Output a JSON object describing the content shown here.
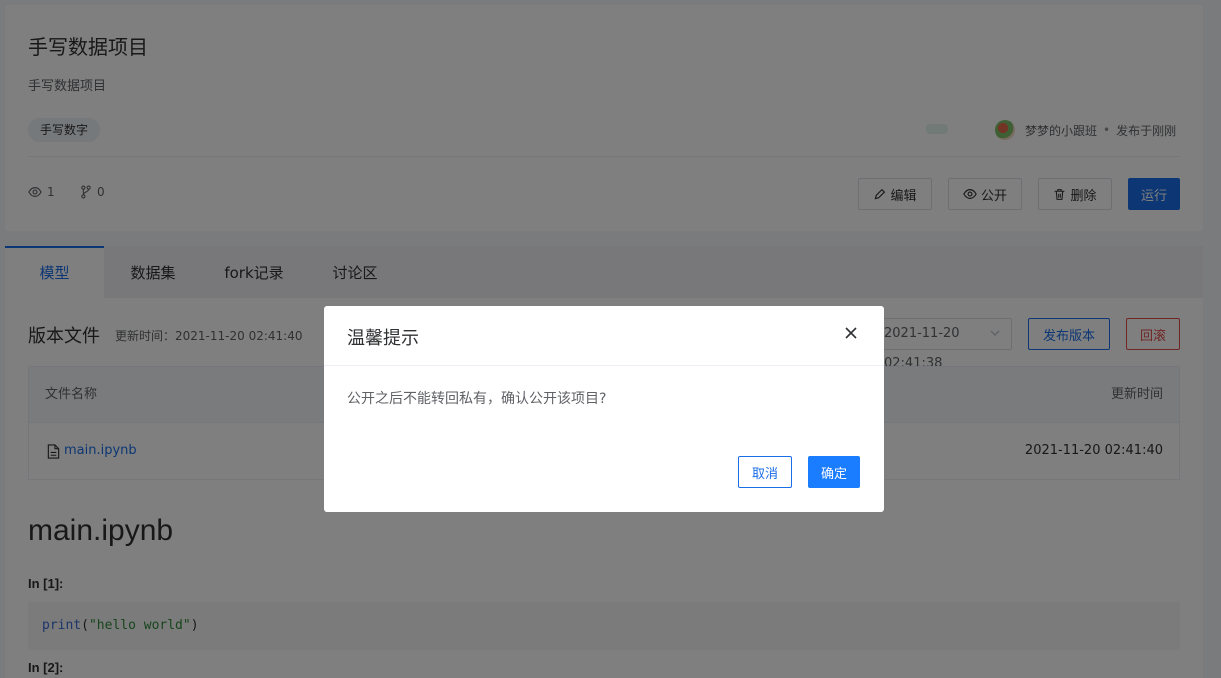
{
  "project": {
    "title": "手写数据项目",
    "description": "手写数据项目",
    "tag": "手写数字",
    "author": "梦梦的小跟班",
    "published": "发布于刚刚",
    "separator": "•",
    "views": "1",
    "forks": "0"
  },
  "actions": {
    "edit": "编辑",
    "public": "公开",
    "delete": "删除",
    "run": "运行"
  },
  "tabs": [
    {
      "label": "模型",
      "active": true
    },
    {
      "label": "数据集",
      "active": false
    },
    {
      "label": "fork记录",
      "active": false
    },
    {
      "label": "讨论区",
      "active": false
    }
  ],
  "version": {
    "title": "版本文件",
    "update_time_label": "更新时间：",
    "update_time": "2021-11-20 02:41:40",
    "selected_version": "2021-11-20 02:41:38",
    "publish_label": "发布版本",
    "rollback_label": "回滚"
  },
  "file_table": {
    "columns": [
      "文件名称",
      "更新时间"
    ],
    "rows": [
      {
        "name": "main.ipynb",
        "updated": "2021-11-20 02:41:40"
      }
    ]
  },
  "notebook": {
    "title": "main.ipynb",
    "cells": [
      {
        "prompt": "In [1]:",
        "code_fn": "print",
        "code_open": "(",
        "code_str": "\"hello world\"",
        "code_close": ")"
      },
      {
        "prompt": "In [2]:"
      }
    ]
  },
  "dialog": {
    "title": "温馨提示",
    "message": "公开之后不能转回私有，确认公开该项目?",
    "cancel": "取消",
    "confirm": "确定"
  },
  "colors": {
    "primary": "#1a6ee8",
    "danger": "#e34d4d",
    "overlay": "rgba(0,0,0,0.5)"
  },
  "icons": [
    "eye-icon",
    "fork-icon",
    "edit-icon",
    "delete-icon",
    "file-icon",
    "close-icon",
    "chevron-down-icon"
  ]
}
